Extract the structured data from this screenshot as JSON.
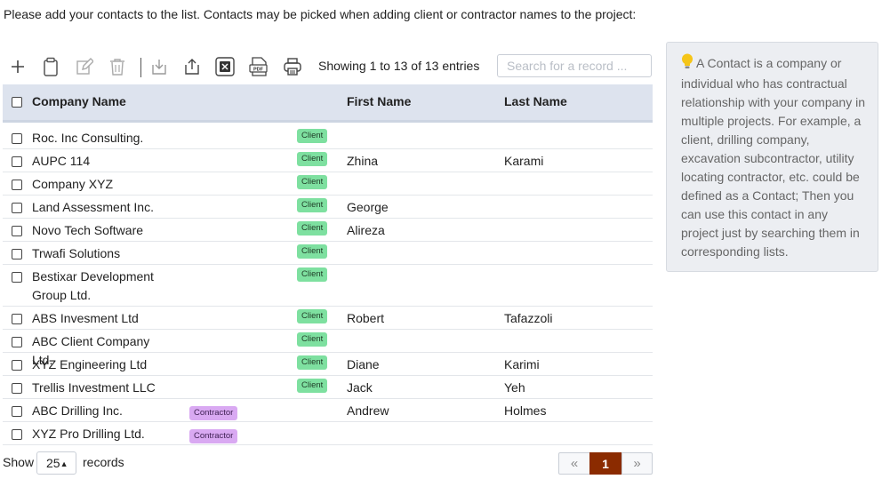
{
  "intro_text": "Please add your contacts to the list. Contacts may be picked when adding client or contractor names to the project:",
  "toolbar": {
    "icons": [
      "plus-icon",
      "clipboard-icon",
      "edit-icon",
      "trash-icon",
      "import-icon",
      "export-icon",
      "excel-icon",
      "pdf-icon",
      "print-icon"
    ],
    "entries_text": "Showing 1 to 13 of 13 entries",
    "search_placeholder": "Search for a record ..."
  },
  "table": {
    "headers": {
      "company": "Company Name",
      "first": "First Name",
      "last": "Last Name"
    },
    "rows": [
      {
        "company": "Roc. Inc Consulting.",
        "type": "Client",
        "first": "",
        "last": ""
      },
      {
        "company": "AUPC 114",
        "type": "Client",
        "first": "Zhina",
        "last": "Karami"
      },
      {
        "company": "Company XYZ",
        "type": "Client",
        "first": "",
        "last": ""
      },
      {
        "company": "Land Assessment Inc.",
        "type": "Client",
        "first": "George",
        "last": ""
      },
      {
        "company": "Novo Tech Software",
        "type": "Client",
        "first": "Alireza",
        "last": ""
      },
      {
        "company": "Trwafi Solutions",
        "type": "Client",
        "first": "",
        "last": ""
      },
      {
        "company": "Bestixar Development Group Ltd.",
        "type": "Client",
        "first": "",
        "last": ""
      },
      {
        "company": "ABS Invesment Ltd",
        "type": "Client",
        "first": "Robert",
        "last": "Tafazzoli"
      },
      {
        "company": "ABC Client Company Ltd.",
        "type": "Client",
        "first": "",
        "last": ""
      },
      {
        "company": "XYZ Engineering Ltd",
        "type": "Client",
        "first": "Diane",
        "last": "Karimi"
      },
      {
        "company": "Trellis Investment LLC",
        "type": "Client",
        "first": "Jack",
        "last": "Yeh"
      },
      {
        "company": "ABC Drilling Inc.",
        "type": "Contractor",
        "first": "Andrew",
        "last": "Holmes"
      },
      {
        "company": "XYZ Pro Drilling Ltd.",
        "type": "Contractor",
        "first": "",
        "last": ""
      }
    ]
  },
  "footer": {
    "show_label": "Show",
    "page_size": "25",
    "records_label": "records",
    "current_page": "1",
    "prev_label": "«",
    "next_label": "»"
  },
  "info_box": {
    "icon": "lightbulb-icon",
    "text": "A Contact is a company or individual who has contractual relationship with your company in multiple projects. For example, a client, drilling company, excavation subcontractor, utility locating contractor, etc. could be defined as a Contact; Then you can use this contact in any project just by searching them in corresponding lists."
  },
  "colors": {
    "header_bg": "#dde3ee",
    "client_badge": "#7ee0a0",
    "contractor_badge": "#d9a9f2",
    "active_page": "#8b2b00",
    "info_bg": "#eceef2"
  }
}
